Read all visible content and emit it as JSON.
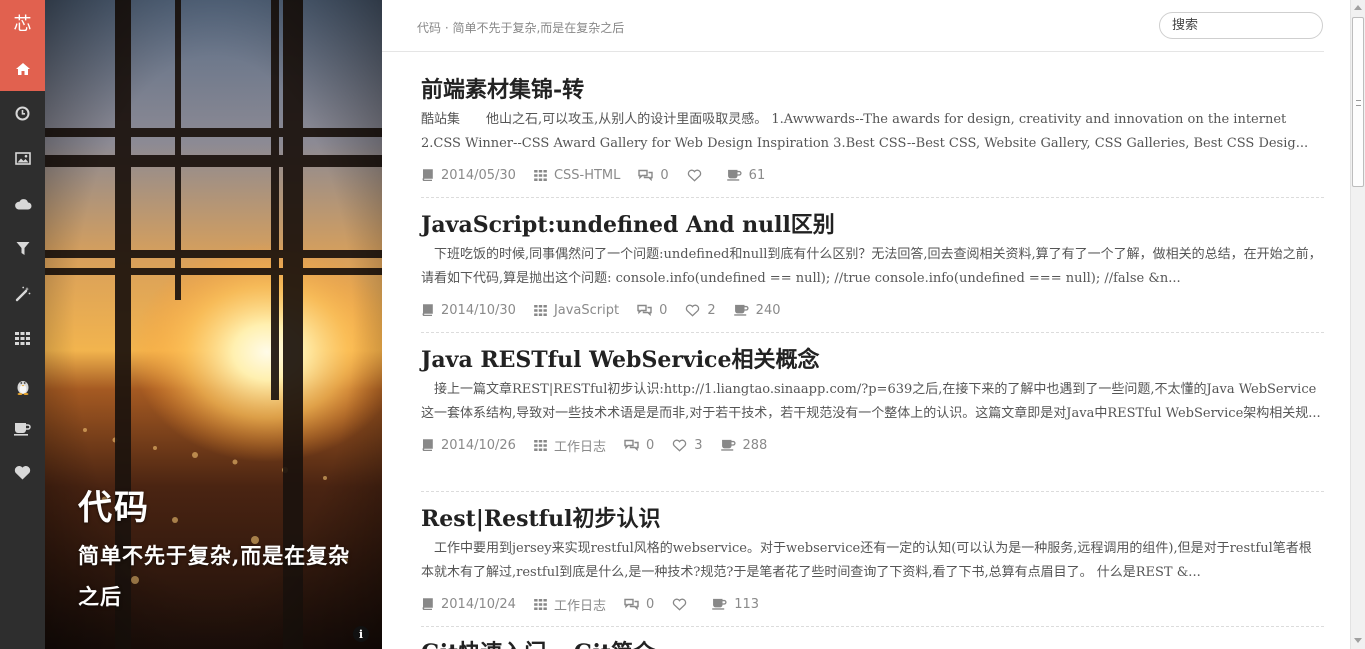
{
  "brand": {
    "glyph": "芯"
  },
  "nav": {
    "items": [
      {
        "id": "home",
        "icon": "home-icon"
      },
      {
        "id": "archive",
        "icon": "clock-icon"
      },
      {
        "id": "gallery",
        "icon": "picture-icon"
      },
      {
        "id": "cloud",
        "icon": "cloud-icon"
      },
      {
        "id": "filter",
        "icon": "filter-icon"
      },
      {
        "id": "magic",
        "icon": "magic-wand-icon"
      },
      {
        "id": "apps",
        "icon": "grid-icon"
      },
      {
        "id": "tux",
        "icon": "penguin-icon"
      },
      {
        "id": "coffee",
        "icon": "coffee-icon"
      },
      {
        "id": "favorites",
        "icon": "heart-icon"
      }
    ],
    "active": "home",
    "colors": {
      "bg": "#2e2e2e",
      "accent": "#e1614f"
    }
  },
  "hero": {
    "title": "代码",
    "subtitle": "简单不先于复杂,而是在复杂之后",
    "info_icon": "info-icon"
  },
  "header": {
    "breadcrumb": "代码 · 简单不先于复杂,而是在复杂之后",
    "search_placeholder": "搜索"
  },
  "posts": [
    {
      "title": "前端素材集锦-转",
      "excerpt": "酷站集　　他山之石,可以攻玉,从别人的设计里面吸取灵感。 1.Awwwards--The awards for design, creativity and innovation on the internet 2.CSS Winner--CSS Award Gallery for Web Design Inspiration 3.Best CSS--Best CSS, Website Gallery, CSS Galleries, Best CSS Desig...",
      "date": "2014/05/30",
      "category": "CSS-HTML",
      "comments": "0",
      "likes": "",
      "views": "61"
    },
    {
      "title": "JavaScript:undefined And null区别",
      "excerpt": "　下班吃饭的时候,同事偶然问了一个问题:undefined和null到底有什么区别？无法回答,回去查阅相关资料,算了有了一个了解，做相关的总结，在开始之前，请看如下代码,算是抛出这个问题: console.info(undefined == null); //true console.info(undefined === null); //false &n...",
      "date": "2014/10/30",
      "category": "JavaScript",
      "comments": "0",
      "likes": "2",
      "views": "240"
    },
    {
      "title": "Java RESTful WebService相关概念",
      "excerpt": "　接上一篇文章REST|RESTful初步认识:http://1.liangtao.sinaapp.com/?p=639之后,在接下来的了解中也遇到了一些问题,不太懂的Java WebService这一套体系结构,导致对一些技术术语是是而非,对于若干技术，若干规范没有一个整体上的认识。这篇文章即是对Java中RESTful WebService架构相关规...",
      "date": "2014/10/26",
      "category": "工作日志",
      "comments": "0",
      "likes": "3",
      "views": "288"
    },
    {
      "title": "Rest|Restful初步认识",
      "excerpt": "　工作中要用到jersey来实现restful风格的webservice。对于webservice还有一定的认知(可以认为是一种服务,远程调用的组件),但是对于restful笔者根本就木有了解过,restful到底是什么,是一种技术?规范?于是笔者花了些时间查询了下资料,看了下书,总算有点眉目了。 什么是REST &...",
      "date": "2014/10/24",
      "category": "工作日志",
      "comments": "0",
      "likes": "",
      "views": "113"
    },
    {
      "title": "Git快速入门---Git简介",
      "excerpt": "",
      "date": "",
      "category": "",
      "comments": "",
      "likes": "",
      "views": ""
    }
  ],
  "meta_icons": {
    "date": "book-icon",
    "category": "grid-icon",
    "comments": "comments-icon",
    "likes": "heart-outline-icon",
    "views": "coffee-icon"
  }
}
